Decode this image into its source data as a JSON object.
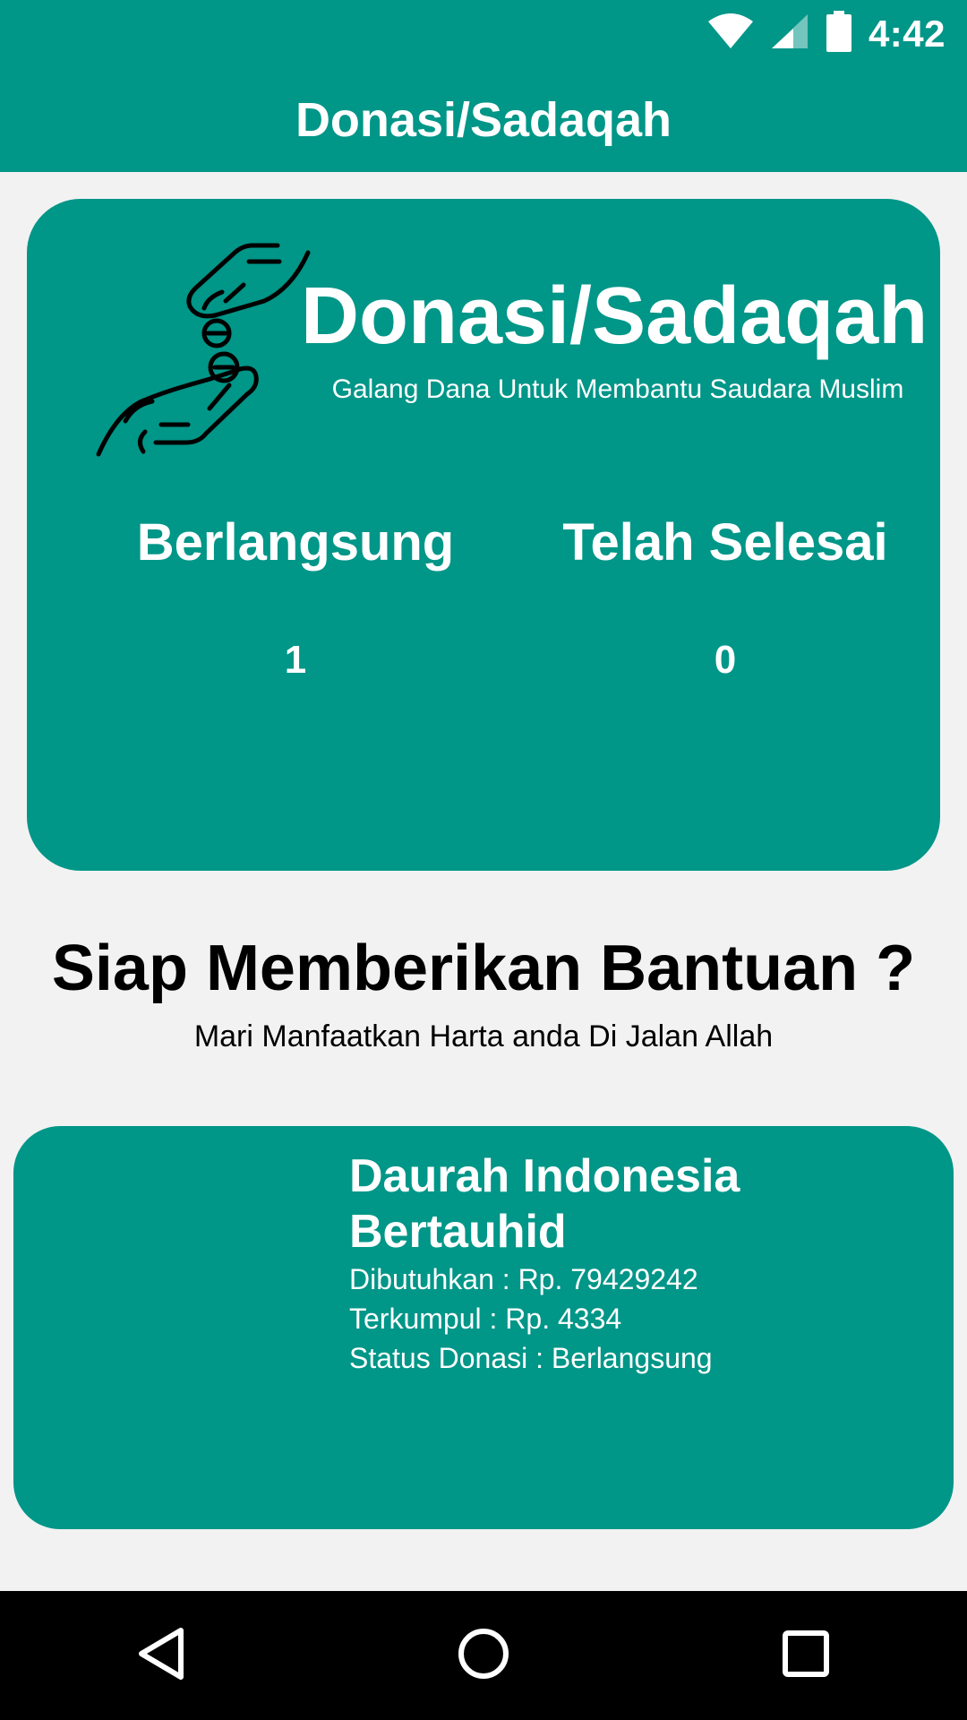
{
  "status_bar": {
    "time": "4:42",
    "icons": [
      "wifi-icon",
      "signal-icon",
      "battery-icon"
    ]
  },
  "app_bar": {
    "title": "Donasi/Sadaqah"
  },
  "hero": {
    "icon": "giving-hands-coin-icon",
    "title": "Donasi/Sadaqah",
    "subtitle": "Galang Dana Untuk Membantu Saudara Muslim",
    "stats": [
      {
        "label": "Berlangsung",
        "value": "1"
      },
      {
        "label": "Telah Selesai",
        "value": "0"
      }
    ]
  },
  "section": {
    "title": "Siap Memberikan Bantuan ?",
    "subtitle": "Mari Manfaatkan Harta  anda Di Jalan Allah"
  },
  "campaigns": [
    {
      "title": "Daurah Indonesia Bertauhid",
      "needed": "Dibutuhkan : Rp. 79429242",
      "collected": "Terkumpul : Rp. 4334",
      "status": "Status Donasi : Berlangsung"
    }
  ],
  "nav_bar": {
    "icons": [
      "back-icon",
      "home-icon",
      "recents-icon"
    ]
  },
  "colors": {
    "primary": "#009688",
    "background": "#F2F2F2",
    "text_dark": "#000000",
    "text_light": "#FFFFFF"
  }
}
